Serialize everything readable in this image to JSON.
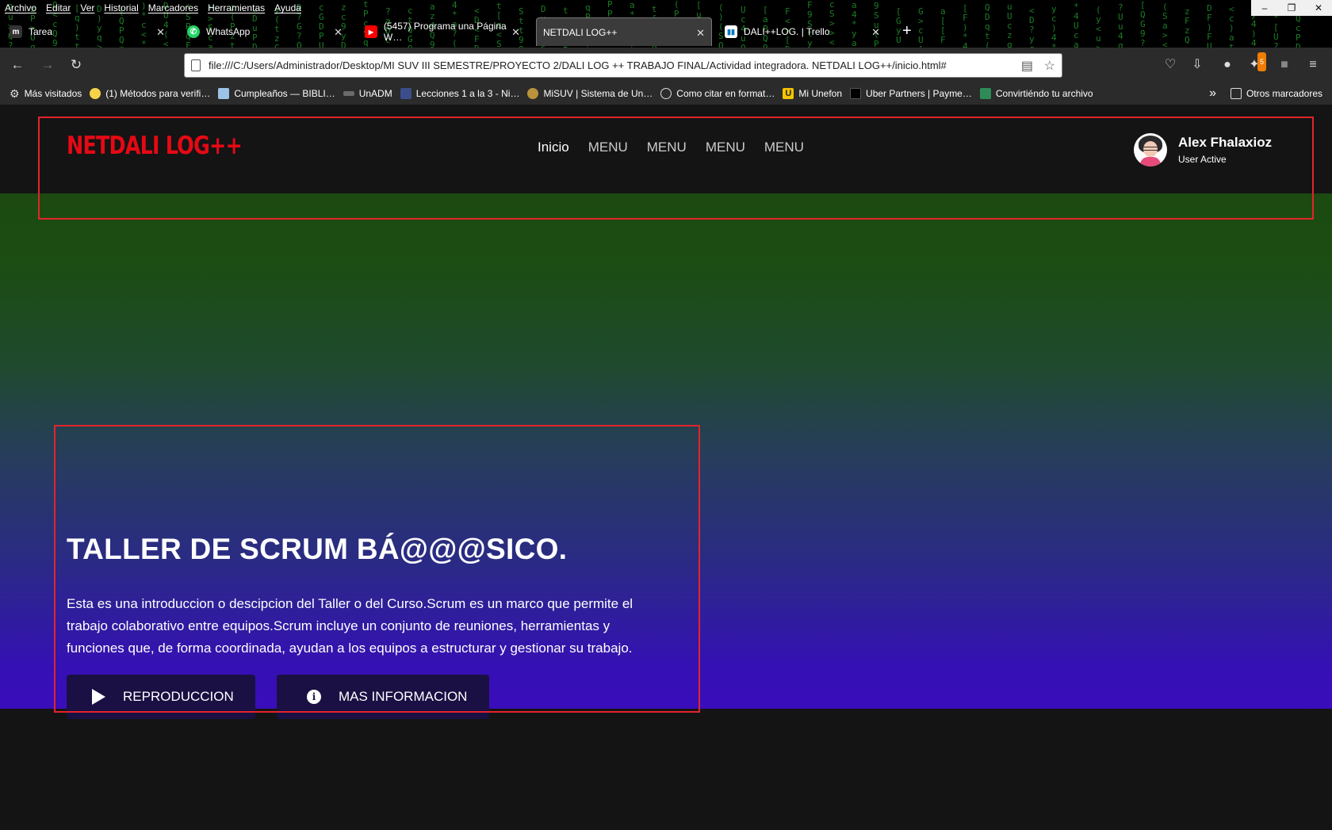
{
  "browser": {
    "menu": [
      "Archivo",
      "Editar",
      "Ver",
      "Historial",
      "Marcadores",
      "Herramientas",
      "Ayuda"
    ],
    "window_controls": [
      "–",
      "❐",
      "✕"
    ],
    "tabs": [
      {
        "title": "Tarea",
        "icon": "moodle-icon",
        "active": false
      },
      {
        "title": "WhatsApp",
        "icon": "whatsapp-icon",
        "active": false
      },
      {
        "title": "(5457) Programa una Página W…",
        "icon": "youtube-icon",
        "active": false
      },
      {
        "title": "NETDALI LOG++",
        "icon": "page-icon",
        "active": true
      },
      {
        "title": "DALI++LOG. | Trello",
        "icon": "trello-icon",
        "active": false
      }
    ],
    "new_tab": "+",
    "url": "file:///C:/Users/Administrador/Desktop/MI SUV III SEMESTRE/PROYECTO 2/DALI LOG ++ TRABAJO FINAL/Actividad integradora. NETDALI LOG++/inicio.html#",
    "extension_badge": "5",
    "bookmarks": [
      {
        "label": "Más visitados",
        "icon": "gear-icon"
      },
      {
        "label": "(1) Métodos para verifi…",
        "icon": "emoji-icon"
      },
      {
        "label": "Cumpleaños — BIBLI…",
        "icon": "bookmark-icon"
      },
      {
        "label": "UnADM",
        "icon": "unadm-icon"
      },
      {
        "label": "Lecciones 1 a la 3 - Ni…",
        "icon": "lesson-icon"
      },
      {
        "label": "MiSUV | Sistema de Un…",
        "icon": "misuv-icon"
      },
      {
        "label": "Como citar en format…",
        "icon": "globe-icon"
      },
      {
        "label": "Mi Unefon",
        "icon": "unefon-icon"
      },
      {
        "label": "Uber Partners | Payme…",
        "icon": "uber-icon"
      },
      {
        "label": "Convirtiéndo tu archivo",
        "icon": "converter-icon"
      }
    ],
    "bookmarks_more": "»",
    "other_bookmarks": "Otros marcadores"
  },
  "site": {
    "logo": "NETDALI LOG++",
    "nav": [
      "Inicio",
      "MENU",
      "MENU",
      "MENU",
      "MENU"
    ],
    "user": {
      "name": "Alex Fhalaxioz",
      "status": "User Active"
    },
    "hero": {
      "title": "TALLER DE SCRUM BÁ@@@SICO.",
      "description": "Esta es una introduccion o descipcion del Taller o del Curso.Scrum es un marco que permite el trabajo colaborativo entre equipos.Scrum incluye un conjunto de reuniones, herramientas y funciones que, de forma coordinada, ayudan a los equipos a estructurar y gestionar su trabajo.",
      "play_button": "REPRODUCCION",
      "info_button": "MAS INFORMACION"
    }
  },
  "colors": {
    "brand": "#e50914",
    "annotation": "#e3242b",
    "button_bg": "#1a1043",
    "header_bg": "#141414"
  }
}
